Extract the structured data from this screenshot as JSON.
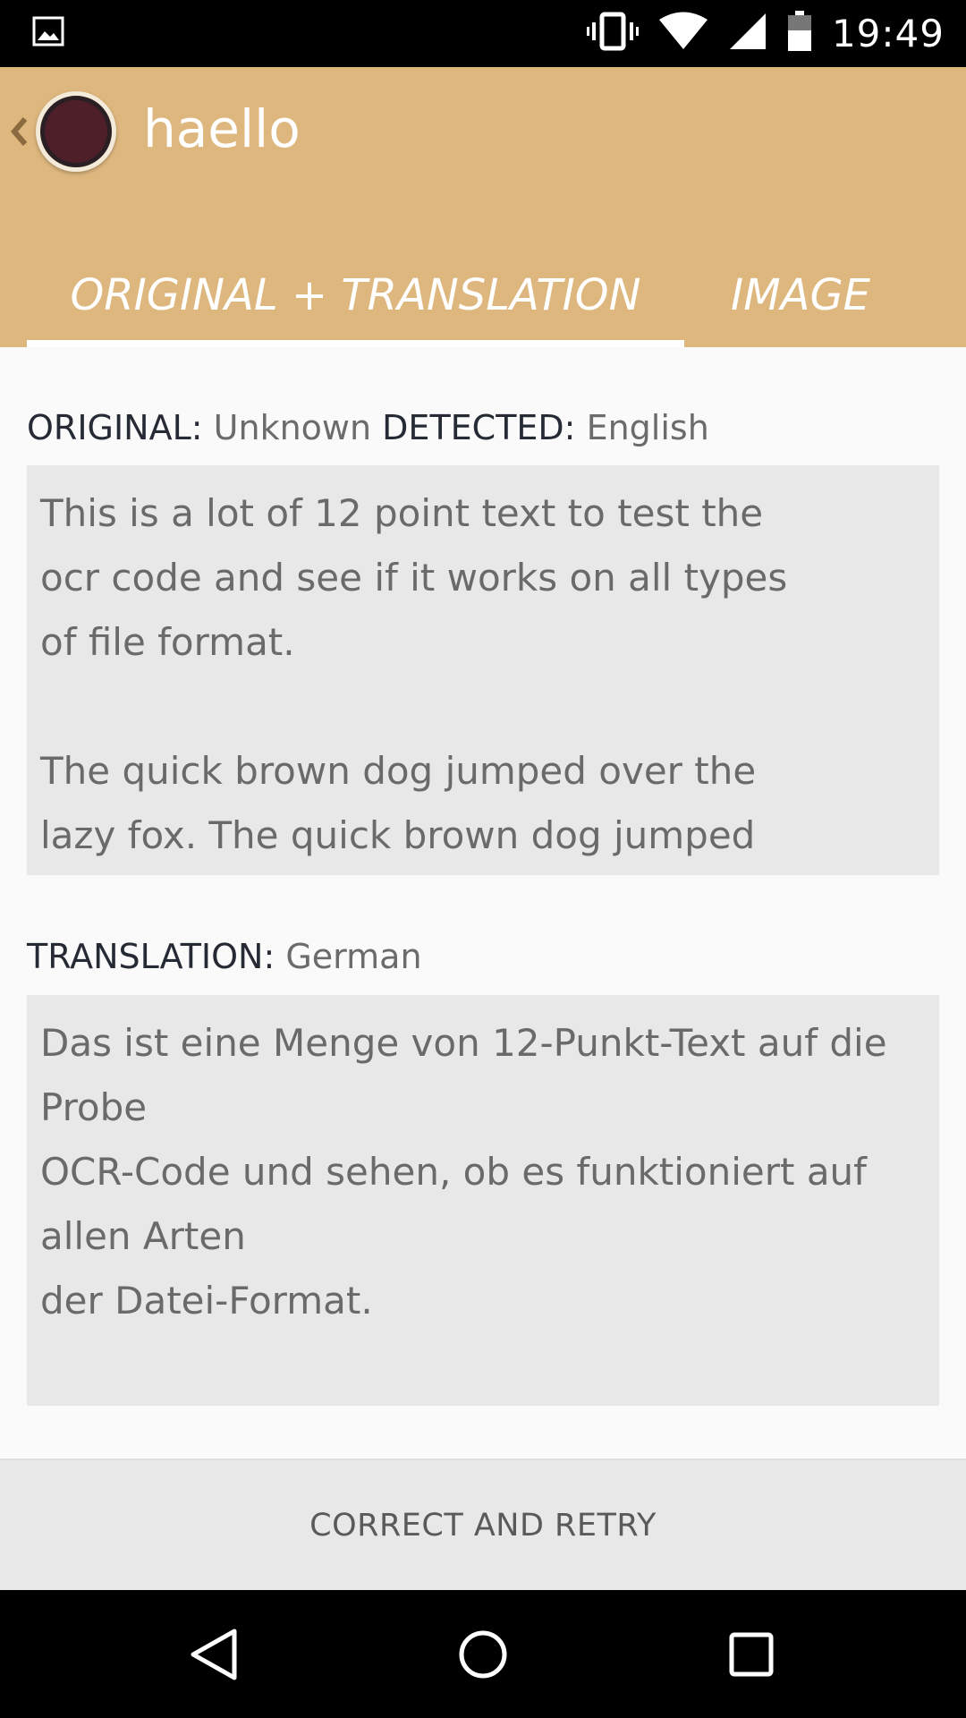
{
  "status_bar": {
    "time": "19:49",
    "icons": [
      "image-icon",
      "vibrate-icon",
      "wifi-icon",
      "signal-icon",
      "battery-icon"
    ]
  },
  "app_bar": {
    "title": "haello",
    "background_color": "#deb77e"
  },
  "tabs": [
    {
      "label": "ORIGINAL + TRANSLATION",
      "selected": true
    },
    {
      "label": "IMAGE",
      "selected": false
    }
  ],
  "original": {
    "label": "ORIGINAL:",
    "language": "Unknown",
    "detected_label": "DETECTED:",
    "detected_language": "English",
    "text": "This is a lot of 12 point text to test the\nocr code and see if it works on all types\nof file format.\n\nThe quick brown dog jumped over the\nlazy fox. The quick brown dog jumped"
  },
  "translation": {
    "label": "TRANSLATION:",
    "language": "German",
    "text": "Das ist eine Menge von 12-Punkt-Text auf die\nProbe\nOCR-Code und sehen, ob es funktioniert auf\nallen Arten\nder Datei-Format."
  },
  "action": {
    "label": "CORRECT AND RETRY"
  },
  "nav_bar": {
    "icons": [
      "back-icon",
      "home-icon",
      "recents-icon"
    ]
  }
}
